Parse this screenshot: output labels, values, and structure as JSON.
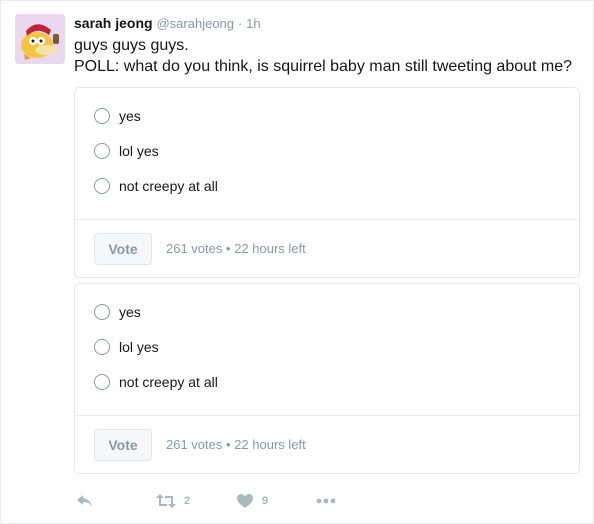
{
  "user": {
    "fullname": "sarah jeong",
    "username": "@sarahjeong",
    "separator": "·",
    "timestamp": "1h"
  },
  "tweet": {
    "line1": "guys guys guys.",
    "line2": "POLL: what do you think, is squirrel baby man still tweeting about me?"
  },
  "polls": [
    {
      "choices": [
        "yes",
        "lol yes",
        "not creepy at all"
      ],
      "vote_label": "Vote",
      "votes": "261 votes",
      "meta_sep": "•",
      "time_left": "22 hours left"
    },
    {
      "choices": [
        "yes",
        "lol yes",
        "not creepy at all"
      ],
      "vote_label": "Vote",
      "votes": "261 votes",
      "meta_sep": "•",
      "time_left": "22 hours left"
    }
  ],
  "actions": {
    "retweet_count": "2",
    "like_count": "9",
    "icons": [
      "reply-icon",
      "retweet-icon",
      "heart-icon",
      "more-icon"
    ]
  },
  "colors": {
    "muted": "#8899a6",
    "border": "#e1e8ed",
    "action": "#aab8c2",
    "avatar_bg": "#e8d9ef",
    "avatar_duck": "#f5c542"
  }
}
